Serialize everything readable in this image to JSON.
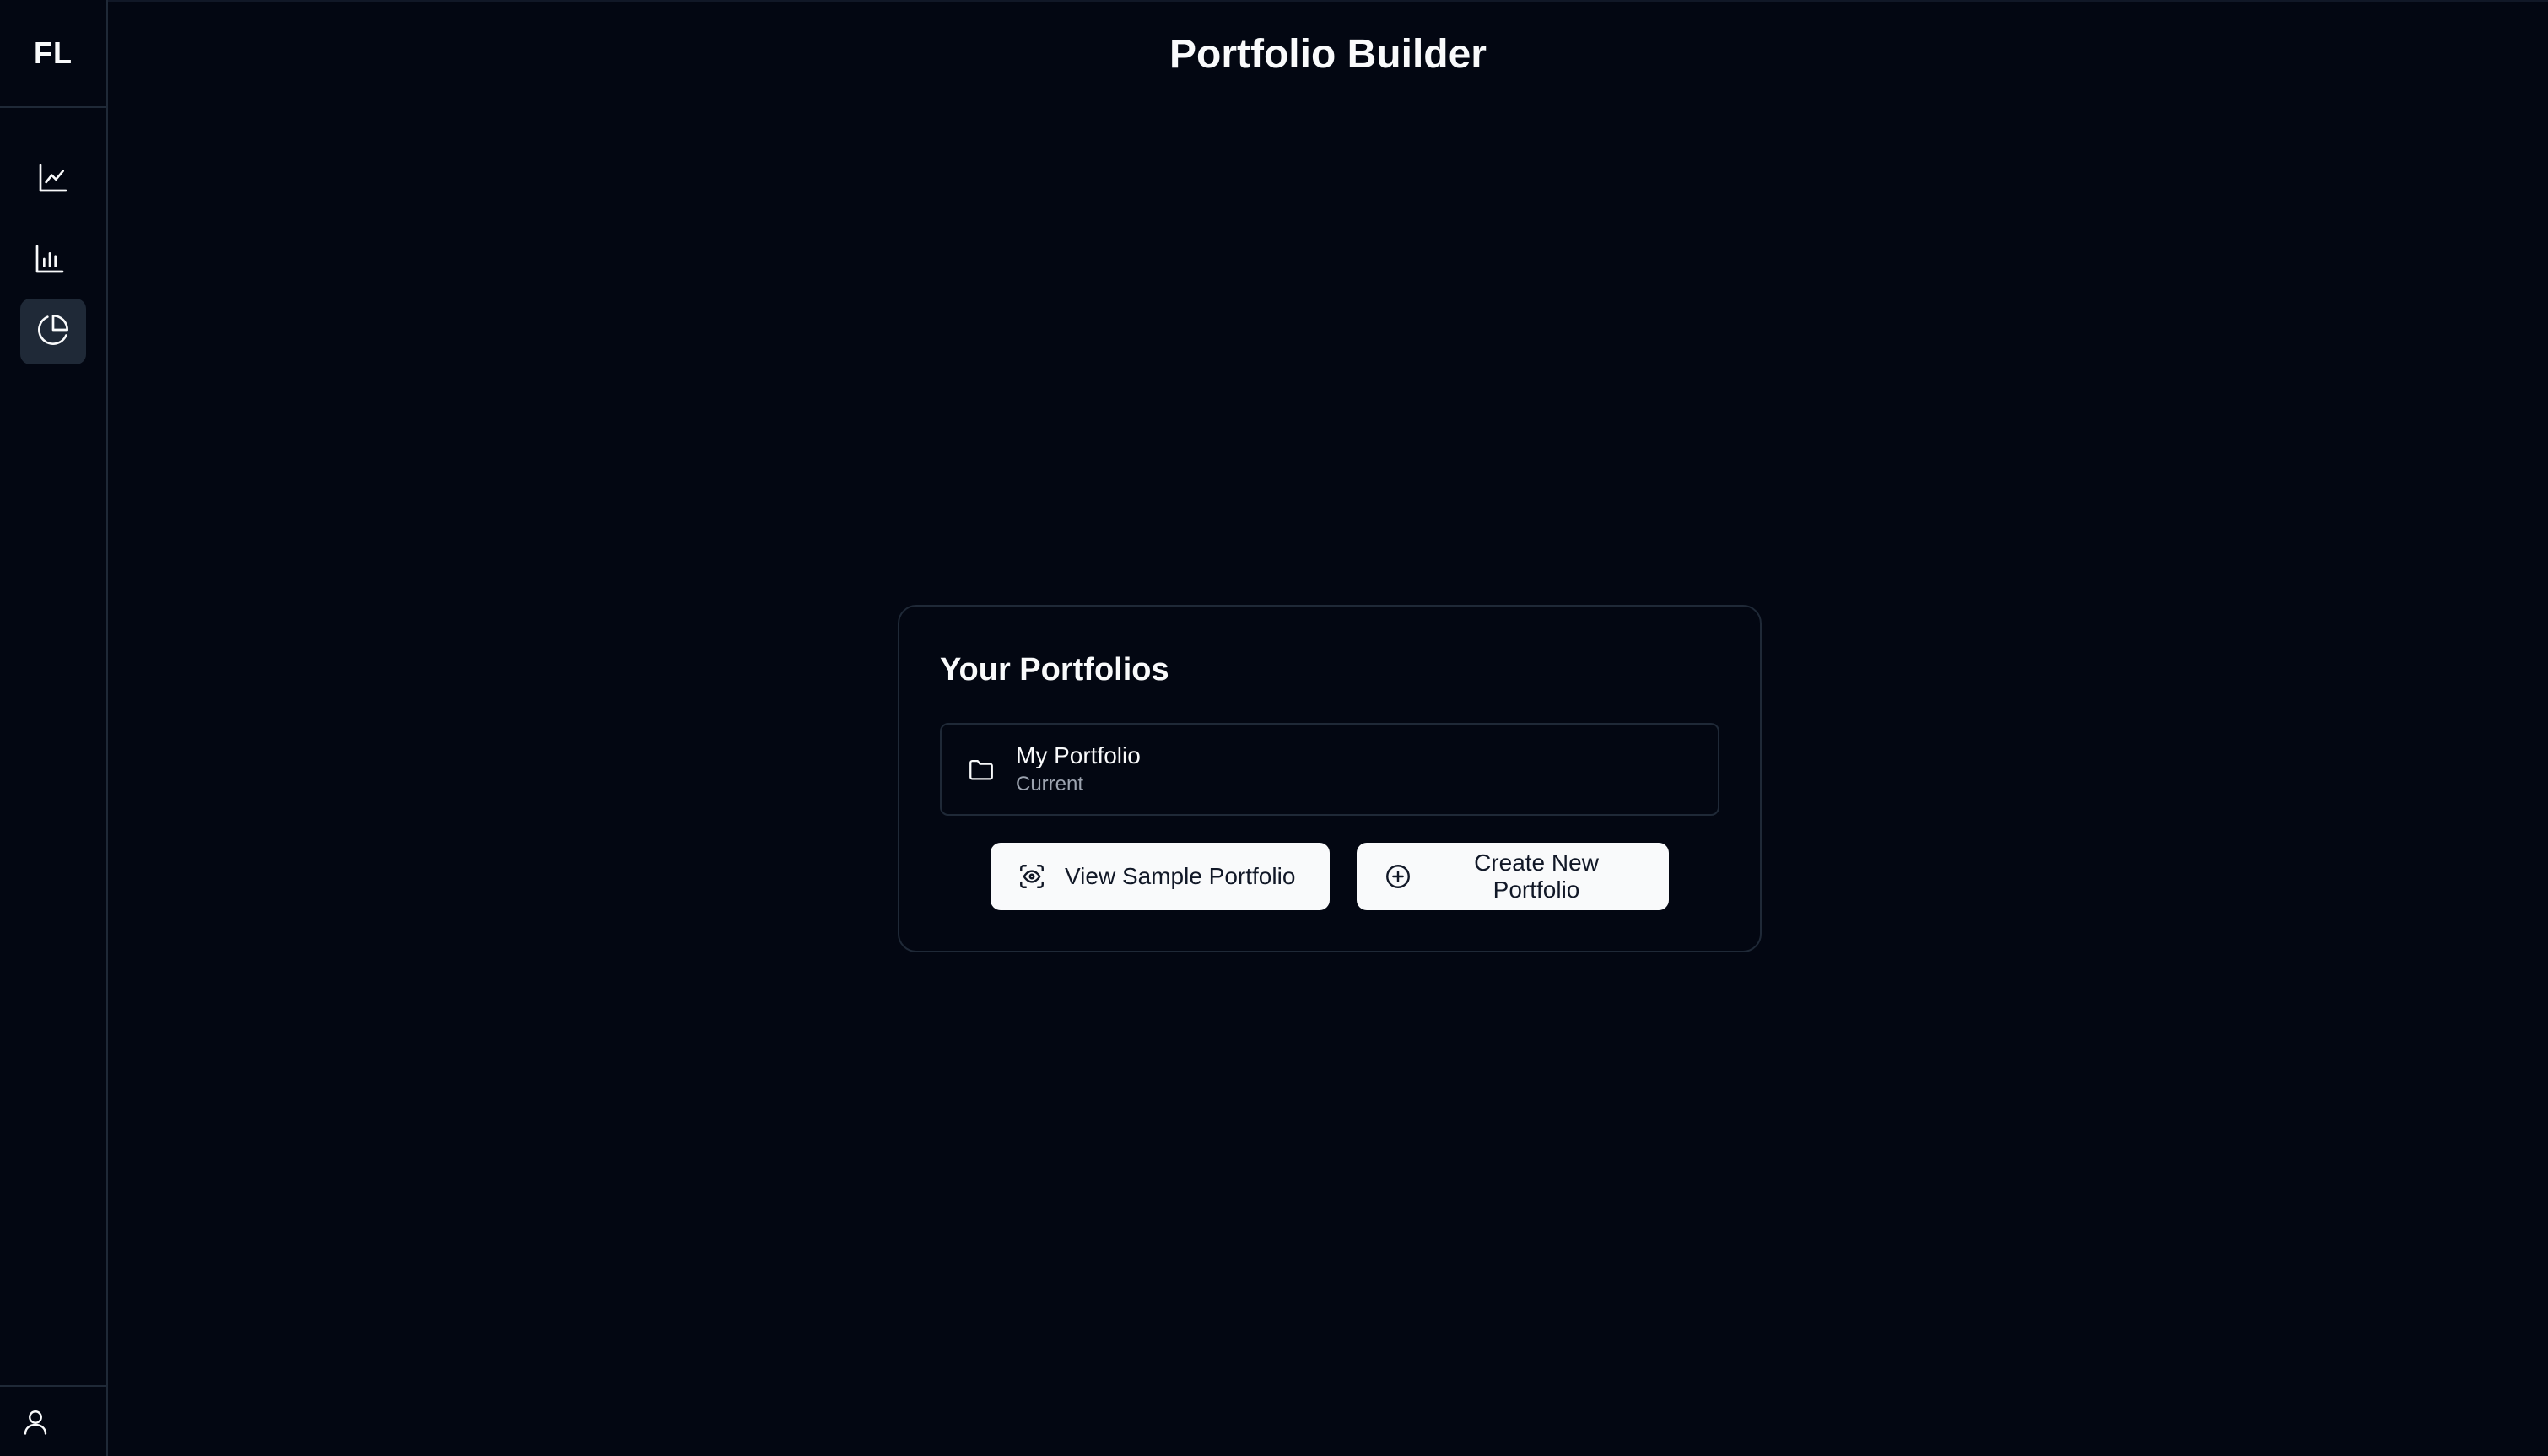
{
  "sidebar": {
    "brand": "FL",
    "nav": [
      {
        "icon": "line-chart-icon",
        "active": false
      },
      {
        "icon": "bar-chart-icon",
        "active": false
      },
      {
        "icon": "pie-chart-icon",
        "active": true
      }
    ],
    "footer_icon": "user-icon"
  },
  "header": {
    "title": "Portfolio Builder"
  },
  "card": {
    "title": "Your Portfolios",
    "portfolios": [
      {
        "name": "My Portfolio",
        "status": "Current",
        "icon": "folder-icon"
      }
    ],
    "actions": {
      "view_sample_label": "View Sample Portfolio",
      "view_sample_icon": "eye-scan-icon",
      "create_new_label": "Create New Portfolio",
      "create_new_icon": "plus-circle-icon"
    }
  },
  "colors": {
    "background": "#030712",
    "border": "#1f2937",
    "active_nav": "#1f2937",
    "text": "#f9fafb",
    "muted_text": "#9ca3af",
    "button_bg": "#f9fafb",
    "button_text": "#111827"
  }
}
